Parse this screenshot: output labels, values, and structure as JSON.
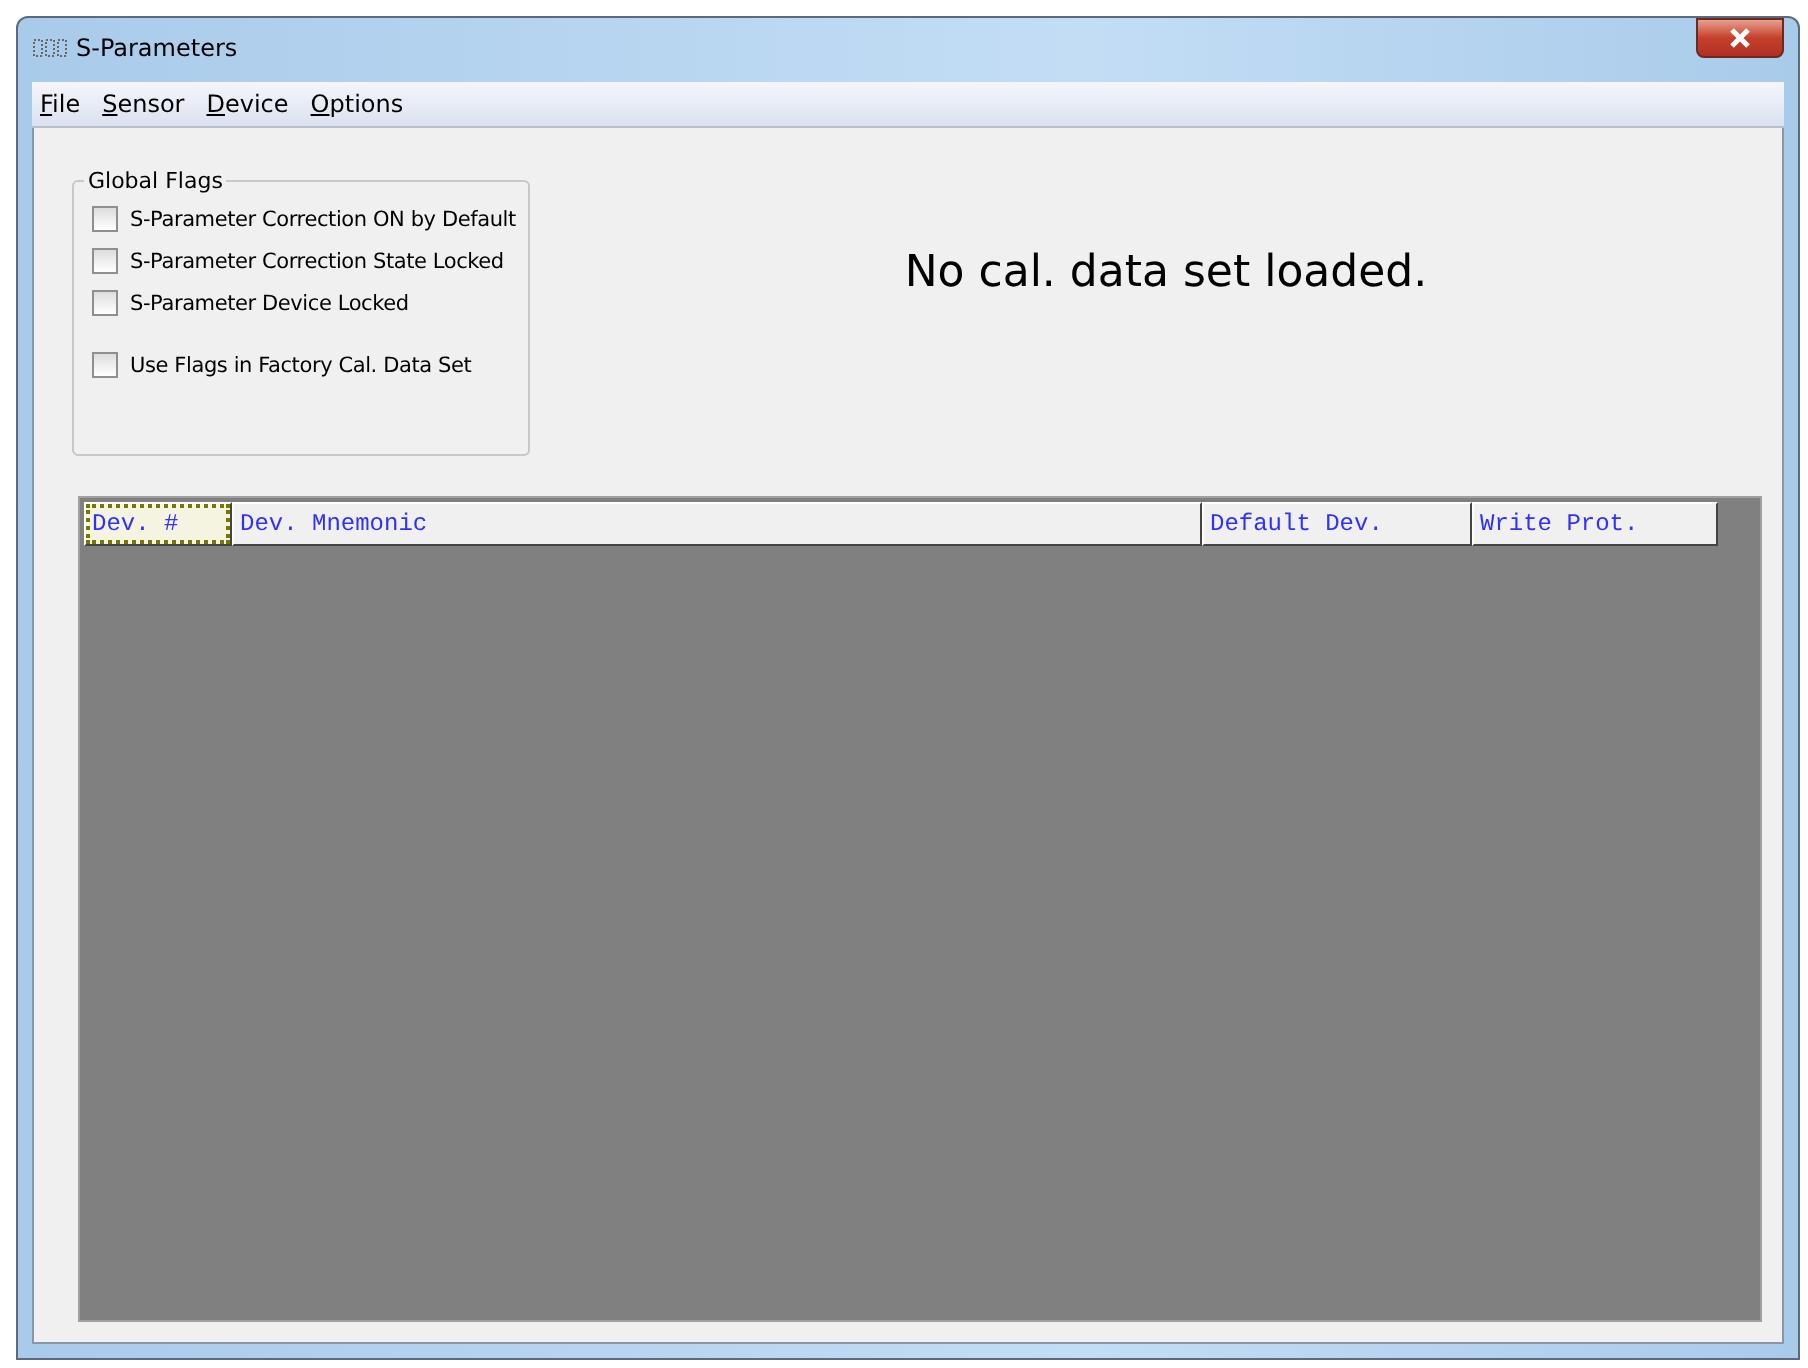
{
  "window": {
    "title": "S-Parameters"
  },
  "menu": [
    {
      "label": "File"
    },
    {
      "label": "Sensor"
    },
    {
      "label": "Device"
    },
    {
      "label": "Options"
    }
  ],
  "global_flags": {
    "title": "Global Flags",
    "options": [
      {
        "label": "S-Parameter Correction ON by Default",
        "checked": false
      },
      {
        "label": "S-Parameter Correction State Locked",
        "checked": false
      },
      {
        "label": "S-Parameter Device Locked",
        "checked": false
      },
      {
        "label": "Use Flags in Factory Cal. Data Set",
        "checked": false,
        "separated": true
      }
    ]
  },
  "status_message": "No cal. data set loaded.",
  "table": {
    "columns": [
      {
        "label": "Dev. #",
        "selected": true
      },
      {
        "label": "Dev. Mnemonic",
        "selected": false
      },
      {
        "label": "Default Dev.",
        "selected": false
      },
      {
        "label": "Write Prot.",
        "selected": false
      }
    ]
  }
}
